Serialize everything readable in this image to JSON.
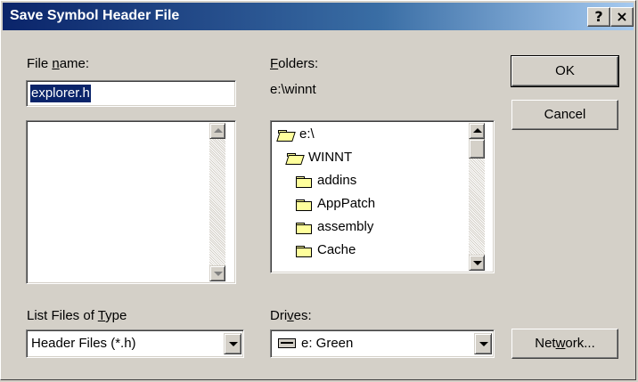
{
  "window": {
    "title": "Save Symbol Header File",
    "help_button": "?",
    "close_button": "×"
  },
  "file_name": {
    "label_pre": "File ",
    "label_key": "n",
    "label_post": "ame:",
    "value": "explorer.h"
  },
  "folders": {
    "label_key": "F",
    "label_post": "olders:",
    "current_path": "e:\\winnt",
    "items": [
      {
        "name": "e:\\",
        "icon": "open-folder-icon",
        "indent": 0
      },
      {
        "name": "WINNT",
        "icon": "open-folder-icon",
        "indent": 1
      },
      {
        "name": "addins",
        "icon": "folder-icon",
        "indent": 2
      },
      {
        "name": "AppPatch",
        "icon": "folder-icon",
        "indent": 2
      },
      {
        "name": "assembly",
        "icon": "folder-icon",
        "indent": 2
      },
      {
        "name": "Cache",
        "icon": "folder-icon",
        "indent": 2
      }
    ]
  },
  "file_type": {
    "label_pre": "List Files of ",
    "label_key": "T",
    "label_post": "ype",
    "selected": "Header Files (*.h)"
  },
  "drives": {
    "label_pre": "Dri",
    "label_key": "v",
    "label_post": "es:",
    "selected": "e: Green",
    "icon": "drive-icon"
  },
  "buttons": {
    "ok": "OK",
    "cancel": "Cancel",
    "network_pre": "Net",
    "network_key": "w",
    "network_post": "ork..."
  },
  "colors": {
    "title_start": "#0a246a",
    "title_end": "#a6caf0",
    "selection": "#0a246a",
    "face": "#d4d0c8"
  }
}
